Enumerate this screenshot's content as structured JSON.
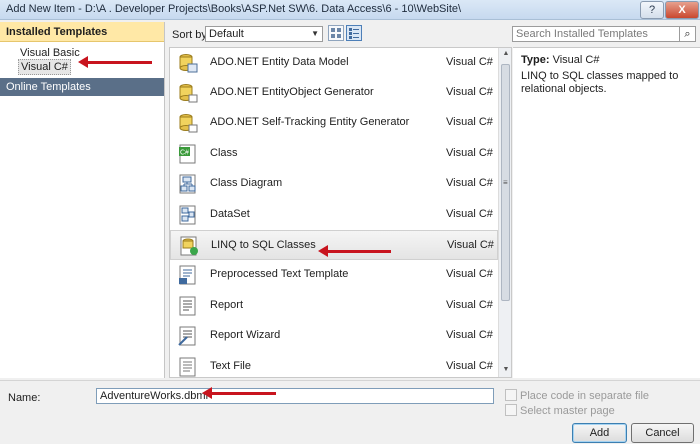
{
  "window": {
    "title": "Add New Item - D:\\A . Developer Projects\\Books\\ASP.Net SW\\6. Data Access\\6 - 10\\WebSite\\",
    "help_label": "?",
    "close_label": "X"
  },
  "sidebar": {
    "installed_header": "Installed Templates",
    "items": [
      {
        "label": "Visual Basic"
      },
      {
        "label": "Visual C#"
      }
    ],
    "online_header": "Online Templates"
  },
  "toolbar": {
    "sort_label": "Sort by:",
    "sort_value": "Default",
    "search_placeholder": "Search Installed Templates"
  },
  "templates": [
    {
      "name": "ADO.NET Entity Data Model",
      "category": "Visual C#",
      "icon": "entity-model-icon"
    },
    {
      "name": "ADO.NET EntityObject Generator",
      "category": "Visual C#",
      "icon": "entity-generator-icon"
    },
    {
      "name": "ADO.NET Self-Tracking Entity Generator",
      "category": "Visual C#",
      "icon": "self-tracking-generator-icon"
    },
    {
      "name": "Class",
      "category": "Visual C#",
      "icon": "class-icon"
    },
    {
      "name": "Class Diagram",
      "category": "Visual C#",
      "icon": "class-diagram-icon"
    },
    {
      "name": "DataSet",
      "category": "Visual C#",
      "icon": "dataset-icon"
    },
    {
      "name": "LINQ to SQL Classes",
      "category": "Visual C#",
      "icon": "linq-to-sql-icon"
    },
    {
      "name": "Preprocessed Text Template",
      "category": "Visual C#",
      "icon": "text-template-icon"
    },
    {
      "name": "Report",
      "category": "Visual C#",
      "icon": "report-icon"
    },
    {
      "name": "Report Wizard",
      "category": "Visual C#",
      "icon": "report-wizard-icon"
    },
    {
      "name": "Text File",
      "category": "Visual C#",
      "icon": "text-file-icon"
    }
  ],
  "description": {
    "type_label": "Type:",
    "type_value": "Visual C#",
    "text": "LINQ to SQL classes mapped to relational objects."
  },
  "form": {
    "name_label": "Name:",
    "name_value": "AdventureWorks.dbml",
    "place_code_label": "Place code in separate file",
    "master_page_label": "Select master page"
  },
  "buttons": {
    "add": "Add",
    "cancel": "Cancel"
  },
  "colors": {
    "annotation_arrow": "#c8141e",
    "installed_header_bg": "#ffe8a6",
    "online_header_bg": "#5a6f88"
  }
}
